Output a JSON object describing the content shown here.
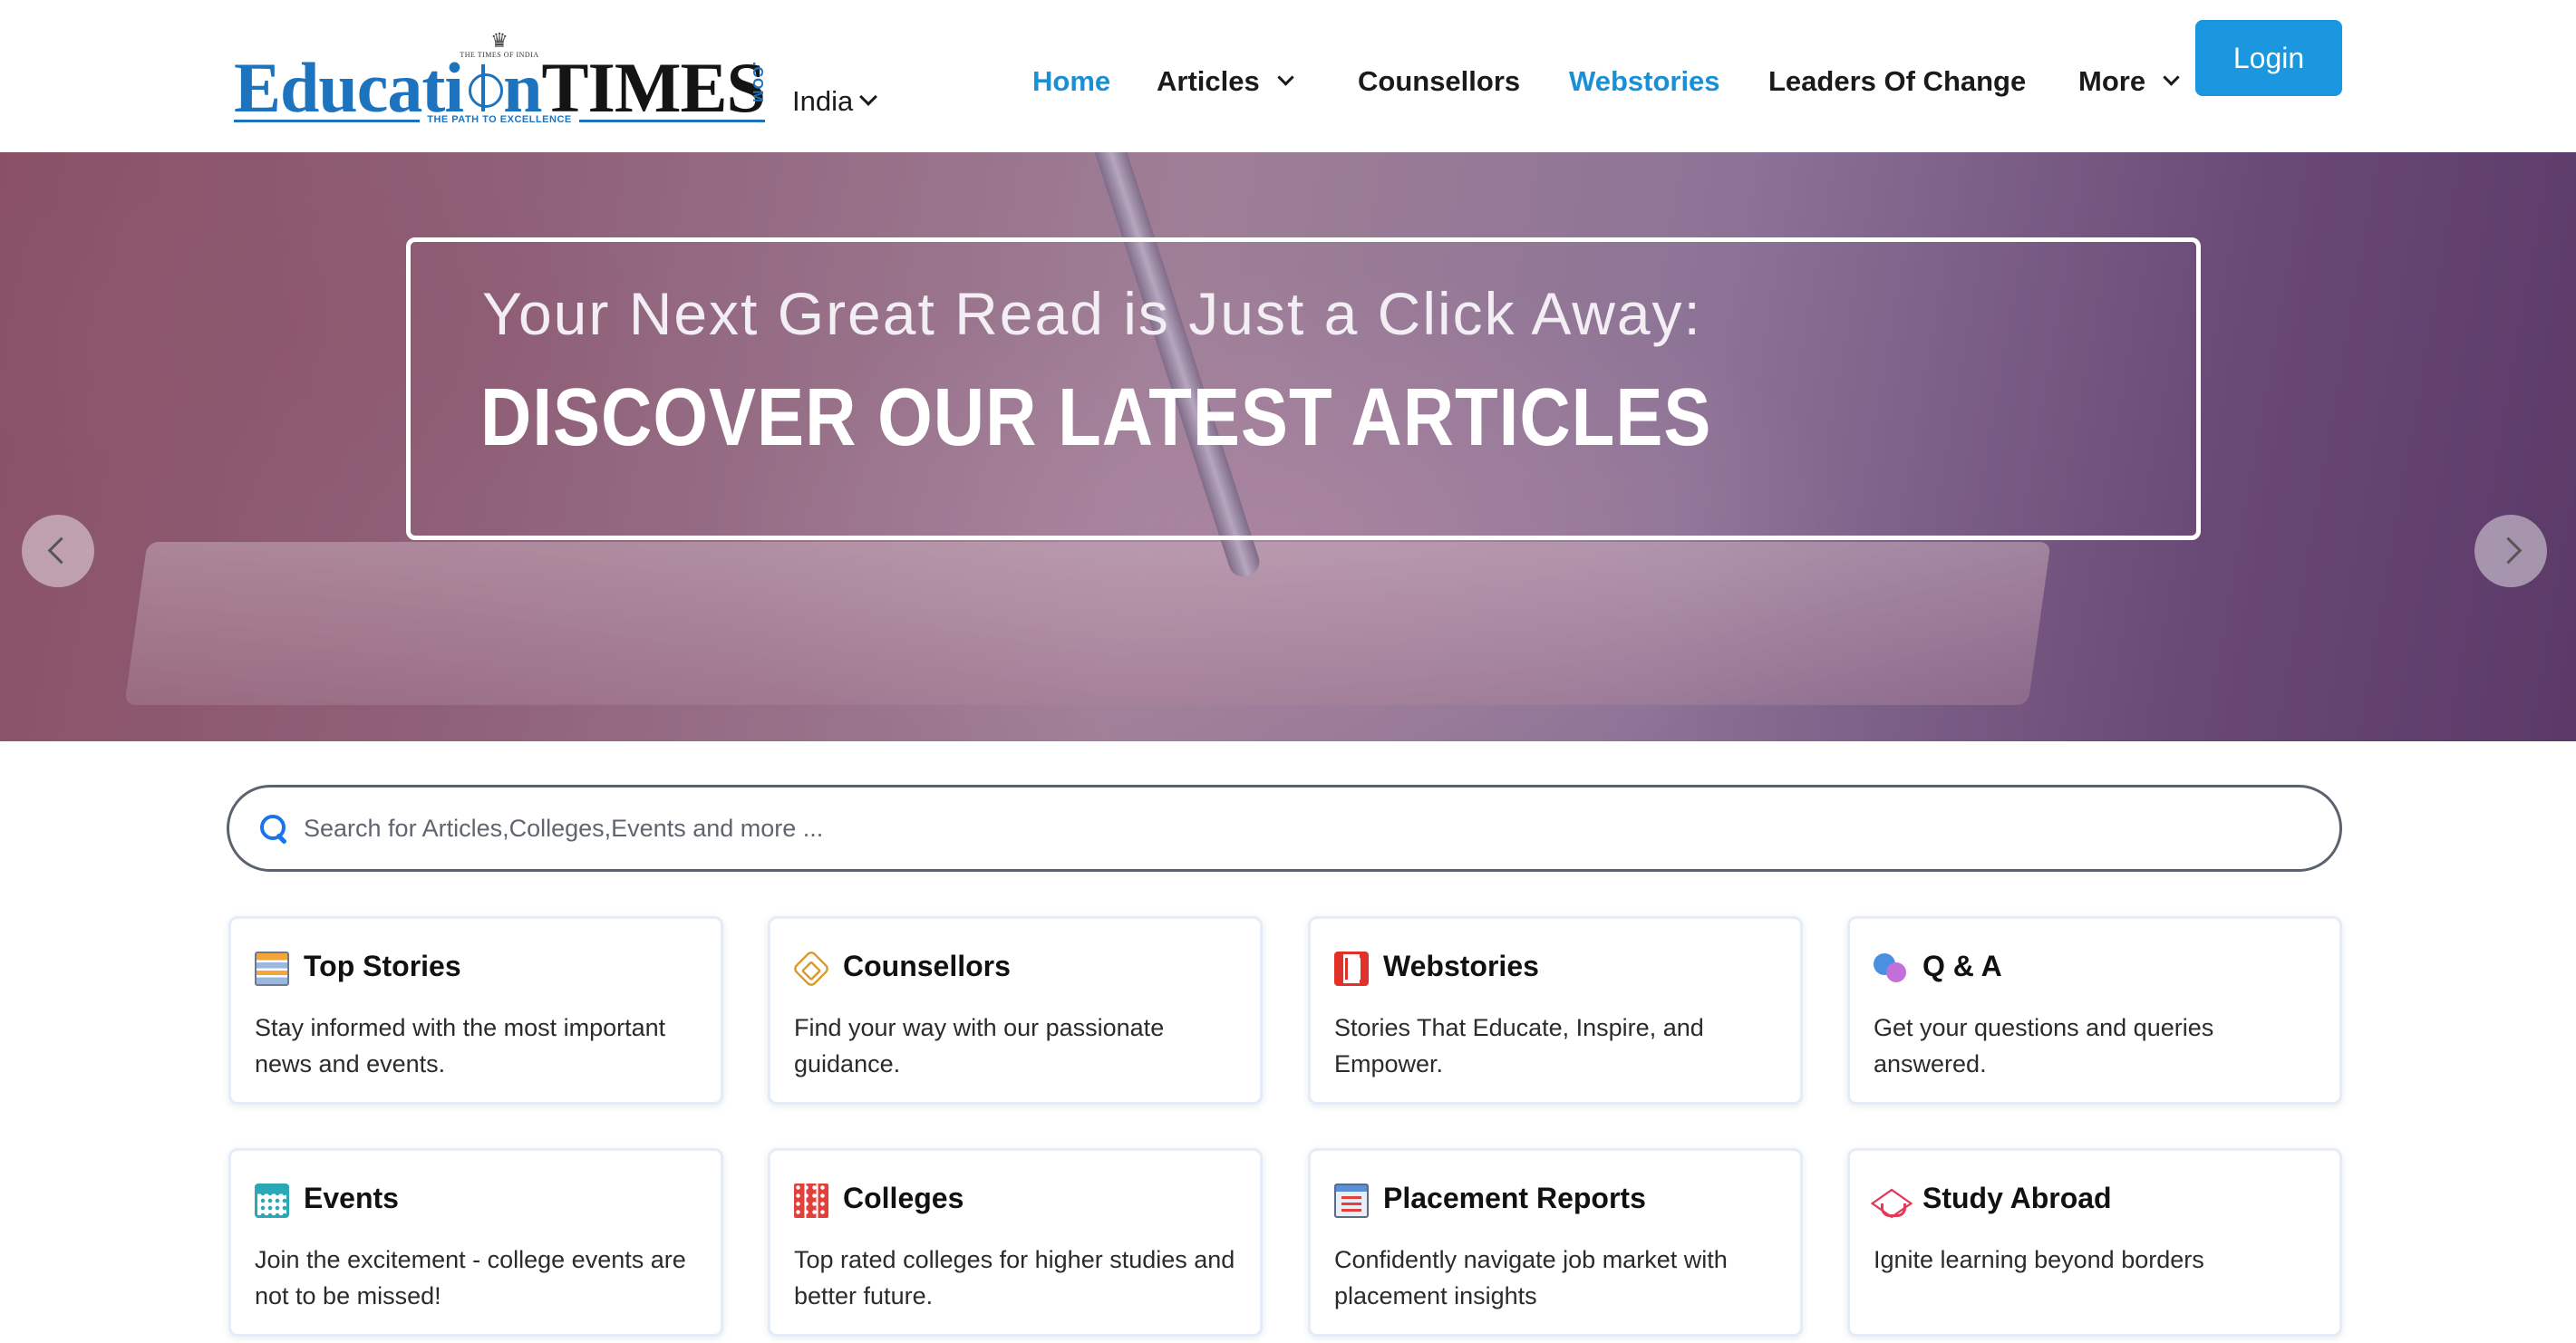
{
  "header": {
    "logo": {
      "brand_part1": "Educati",
      "brand_part2": "n",
      "brand_part3": "TIMES",
      "brand_suffix": ".COM",
      "seal_text": "THE TIMES OF INDIA",
      "tagline": "THE PATH TO EXCELLENCE"
    },
    "region": {
      "label": "India"
    },
    "nav": [
      {
        "label": "Home",
        "active": true,
        "dropdown": false
      },
      {
        "label": "Articles",
        "active": false,
        "dropdown": true
      },
      {
        "label": "Counsellors",
        "active": false,
        "dropdown": false
      },
      {
        "label": "Webstories",
        "active": true,
        "dropdown": false
      },
      {
        "label": "Leaders Of Change",
        "active": false,
        "dropdown": false
      },
      {
        "label": "More",
        "active": false,
        "dropdown": true
      }
    ],
    "login_label": "Login"
  },
  "hero": {
    "line1": "Your Next Great Read is Just a Click Away:",
    "line2": "DISCOVER OUR LATEST ARTICLES"
  },
  "search": {
    "placeholder": "Search for Articles,Colleges,Events and more ..."
  },
  "cards": [
    {
      "title": "Top Stories",
      "description": "Stay informed with the most important news and events.",
      "icon": "newspaper-icon"
    },
    {
      "title": "Counsellors",
      "description": "Find your way with our passionate guidance.",
      "icon": "handshake-icon"
    },
    {
      "title": "Webstories",
      "description": "Stories That Educate, Inspire, and Empower.",
      "icon": "film-icon"
    },
    {
      "title": "Q & A",
      "description": "Get your questions and queries answered.",
      "icon": "chat-bubbles-icon"
    },
    {
      "title": "Events",
      "description": "Join the excitement - college events are not to be missed!",
      "icon": "calendar-icon"
    },
    {
      "title": "Colleges",
      "description": "Top rated colleges for higher studies and better future.",
      "icon": "building-icon"
    },
    {
      "title": "Placement Reports",
      "description": "Confidently navigate job market with placement insights",
      "icon": "report-icon"
    },
    {
      "title": "Study Abroad",
      "description": "Ignite learning beyond borders",
      "icon": "graduation-cap-icon"
    }
  ],
  "colors": {
    "accent": "#1a97de",
    "nav_active": "#1a8fd6",
    "brand_blue": "#1e73be"
  }
}
